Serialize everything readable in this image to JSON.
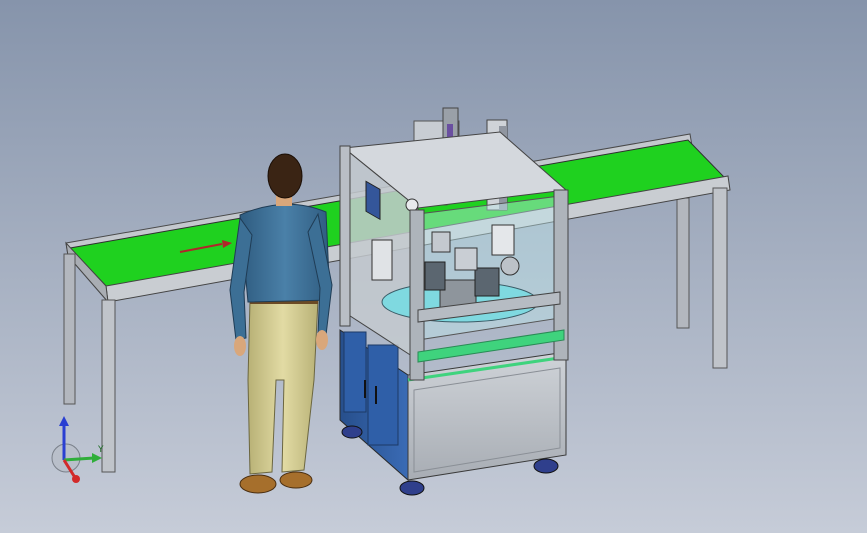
{
  "viewport": {
    "background_top": "#8694ab",
    "background_bottom": "#c6ccd8"
  },
  "conveyor": {
    "belt_color": "#1fd11f",
    "frame_color": "#b9bdc4",
    "direction_arrow_color": "#b0262a"
  },
  "machine": {
    "panel_color": "#2f5fa8",
    "frame_color": "#9aa3ae",
    "glass_color": "#bfe6ec",
    "accent_color": "#3fd37d"
  },
  "operator": {
    "jacket_color": "#3c6f95",
    "pants_color": "#d6cf96",
    "hair_color": "#3a2414"
  },
  "triad": {
    "x_axis_color": "#d22a2a",
    "y_axis_color": "#2fae3a",
    "z_axis_color": "#2a3fd2",
    "y_label": "Y"
  }
}
